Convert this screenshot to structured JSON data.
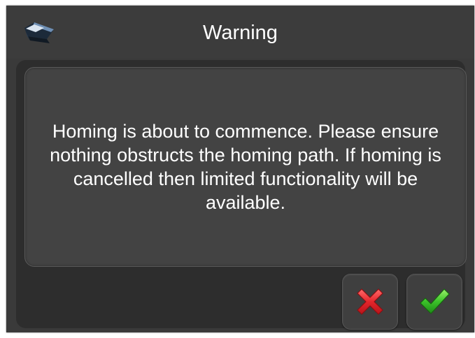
{
  "dialog": {
    "title": "Warning",
    "icon": "warning-printer-icon",
    "message": "Homing is about to commence. Please ensure nothing obstructs the homing path. If homing is cancelled then limited functionality will be available."
  },
  "buttons": {
    "cancel": {
      "icon": "cancel-x-icon",
      "color": "#e4262b"
    },
    "confirm": {
      "icon": "confirm-check-icon",
      "color": "#3cc32a"
    }
  },
  "colors": {
    "dialog_bg": "#3a3a3a",
    "panel_bg": "#434343",
    "text": "#ffffff"
  }
}
